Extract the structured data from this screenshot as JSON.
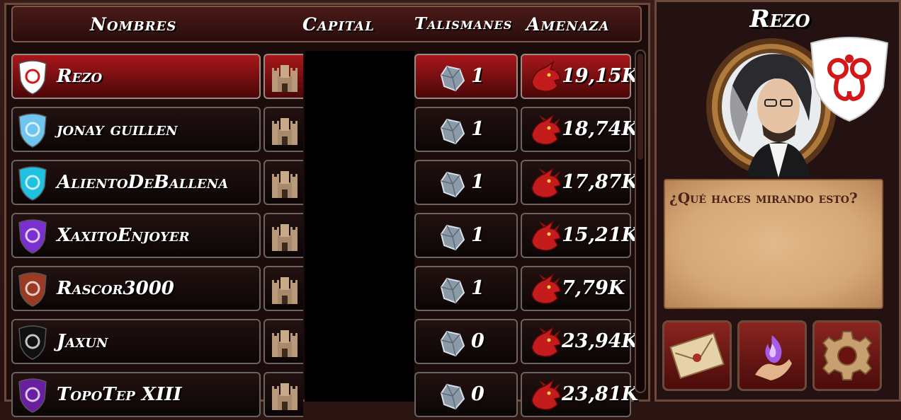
{
  "headers": {
    "name": "Nombres",
    "capital": "Capital",
    "talismans": "Talismanes",
    "threat": "Amenaza"
  },
  "players": [
    {
      "name": "Rezo",
      "talismans": "1",
      "threat": "19,15K",
      "shield_color": "#ffffff",
      "emblem": "red-serpent-emblem-icon",
      "selected": true
    },
    {
      "name": "jonay guillen",
      "talismans": "1",
      "threat": "18,74K",
      "shield_color": "#6ec6f0",
      "emblem": "ship-emblem-icon",
      "selected": false
    },
    {
      "name": "AlientoDeBallena",
      "talismans": "1",
      "threat": "17,87K",
      "shield_color": "#1fc0e0",
      "emblem": "snowflake-emblem-icon",
      "selected": false
    },
    {
      "name": "XaxitoEnjoyer",
      "talismans": "1",
      "threat": "15,21K",
      "shield_color": "#7b2fd0",
      "emblem": "purple-crest-emblem-icon",
      "selected": false
    },
    {
      "name": "Rascor3000",
      "talismans": "1",
      "threat": "7,79K",
      "shield_color": "#9a3a22",
      "emblem": "bronze-crest-emblem-icon",
      "selected": false
    },
    {
      "name": "Jaxun",
      "talismans": "0",
      "threat": "23,94K",
      "shield_color": "#111111",
      "emblem": "purple-horse-emblem-icon",
      "selected": false
    },
    {
      "name": "TopoTep XIII",
      "talismans": "0",
      "threat": "23,81K",
      "shield_color": "#6a1fa0",
      "emblem": "crown-emblem-icon",
      "selected": false
    }
  ],
  "profile": {
    "name": "Rezo",
    "quote": "¿Qué haces mirando esto?"
  },
  "colors": {
    "selected_row": "#a8171a",
    "parchment": "#d6a877",
    "frame_border": "#6b4a3a"
  },
  "actions": {
    "mail_icon": "letter-icon",
    "magic_icon": "magic-hand-icon",
    "settings_icon": "gear-icon"
  }
}
